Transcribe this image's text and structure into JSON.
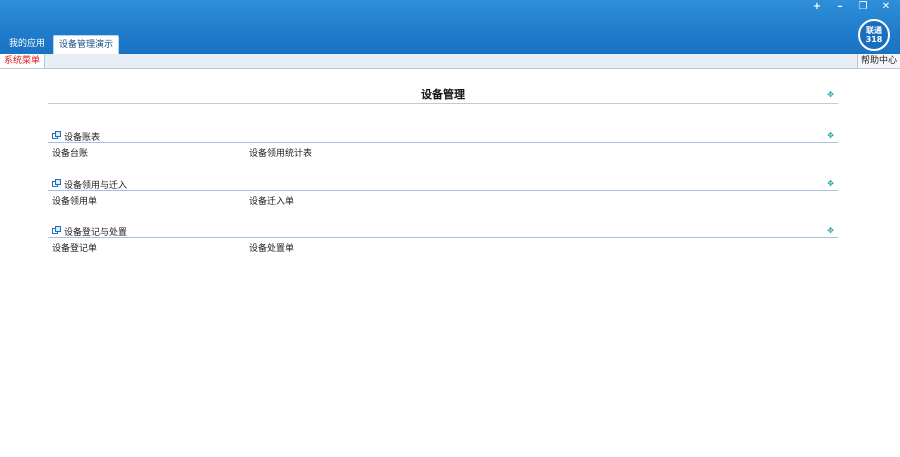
{
  "window": {
    "controls": [
      "+",
      "–",
      "❐",
      "✕"
    ]
  },
  "logo": {
    "line1": "联通",
    "line2": "318"
  },
  "tabs": [
    {
      "label": "我的应用",
      "active": false
    },
    {
      "label": "设备管理演示",
      "active": true
    }
  ],
  "subbar": {
    "system_menu": "系统菜单",
    "help": "帮助中心"
  },
  "page": {
    "title": "设备管理",
    "expand_icon": "✥"
  },
  "sections": [
    {
      "title": "设备账表",
      "items": [
        "设备台账",
        "设备领用统计表"
      ]
    },
    {
      "title": "设备领用与迁入",
      "items": [
        "设备领用单",
        "设备迁入单"
      ]
    },
    {
      "title": "设备登记与处置",
      "items": [
        "设备登记单",
        "设备处置单"
      ]
    }
  ],
  "colors": {
    "accent": "#1f7ccc",
    "menu_red": "#e01818",
    "plus_teal": "#1aa59a"
  }
}
